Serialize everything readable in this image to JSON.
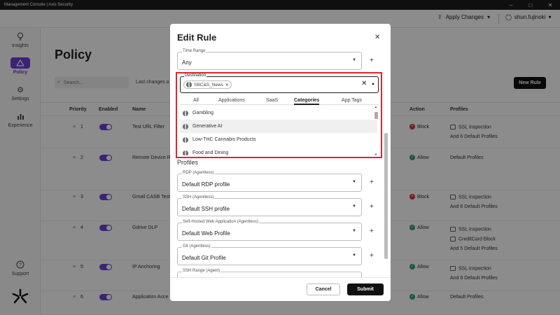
{
  "titlebar": {
    "title": "Management Console | Axis Security"
  },
  "header": {
    "apply_changes": "Apply Changes",
    "username": "shun.fujinoki"
  },
  "sidebar": {
    "items": [
      {
        "label": "Insights",
        "icon": "lightbulb-icon"
      },
      {
        "label": "Policy",
        "icon": "policy-icon"
      },
      {
        "label": "Settings",
        "icon": "gear-icon"
      },
      {
        "label": "Experience",
        "icon": "bar-chart-icon"
      },
      {
        "label": "Support",
        "icon": "help-icon"
      }
    ]
  },
  "main": {
    "title": "Policy",
    "search_placeholder": "Search...",
    "last_changes": "Last changes a",
    "new_rule": "New Rule",
    "columns": {
      "priority": "Priority",
      "enabled": "Enabled",
      "name": "Name",
      "action": "Action",
      "profiles": "Profiles"
    },
    "rows": [
      {
        "priority": "1",
        "name": "Test URL Filter",
        "action": "Block",
        "profile1": "SSL Inspection",
        "profile2": "And 6 Default Profiles",
        "profile3": ""
      },
      {
        "priority": "2",
        "name": "Remote Device R",
        "action": "Allow",
        "profile1": "Default Profiles",
        "profile2": "",
        "profile3": ""
      },
      {
        "priority": "3",
        "name": "Gmail CASB Test",
        "action": "Block",
        "profile1": "SSL Inspection",
        "profile2": "And 6 Default Profiles",
        "profile3": ""
      },
      {
        "priority": "4",
        "name": "Gdrive DLP",
        "action": "Allow",
        "profile1": "SSL Inspection",
        "profile2": "CreditCard Block",
        "profile3": "And 5 Default Profiles"
      },
      {
        "priority": "5",
        "name": "IP Anchoring",
        "action": "Allow",
        "profile1": "SSL Inspection",
        "profile2": "And 6 Default Profiles",
        "profile3": ""
      },
      {
        "priority": "6",
        "name": "Application Acce",
        "action": "Allow",
        "profile1": "Default Profiles",
        "profile2": "",
        "profile3": ""
      }
    ]
  },
  "modal": {
    "title": "Edit Rule",
    "time_range": {
      "label": "Time Range",
      "value": "Any"
    },
    "destination": {
      "label": "Destination",
      "chip": "SBC&S_News",
      "tabs": [
        "All",
        "Applications",
        "SaaS",
        "Categories",
        "App Tags"
      ],
      "active_tab": "Categories",
      "options": [
        "Gambling",
        "Generative AI",
        "Low-THC Cannabis Products",
        "Food and Dining"
      ]
    },
    "profiles_heading": "Profiles",
    "profile_fields": [
      {
        "label": "RDP (Agentless)",
        "value": "Default RDP profile"
      },
      {
        "label": "SSH (Agentless)",
        "value": "Default SSH profile"
      },
      {
        "label": "Self-Hosted Web Application (Agentless)",
        "value": "Default Web Profile"
      },
      {
        "label": "Git (Agentless)",
        "value": "Default Git Profile"
      },
      {
        "label": "SSH Range (Agent)",
        "value": ""
      }
    ],
    "cancel": "Cancel",
    "submit": "Submit"
  }
}
